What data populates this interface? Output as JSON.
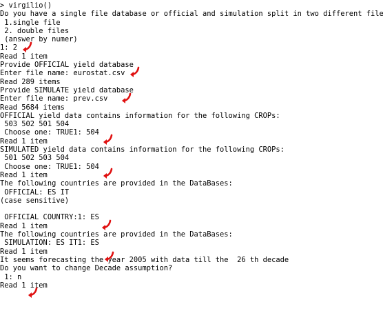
{
  "console": {
    "lines": [
      "> virgilio()",
      "Do you have a single file database or official and simulation split in two different files?",
      " 1.single file",
      " 2. double files",
      " (answer by numer)",
      "1: 2",
      "Read 1 item",
      "Provide OFFICIAL yield database",
      "Enter file name: eurostat.csv",
      "Read 289 items",
      "Provide SIMULATE yield database",
      "Enter file name: prev.csv",
      "Read 5684 items",
      "OFFICIAL yield data contains information for the following CROPs:",
      " 503 502 501 504",
      " Choose one: TRUE1: 504",
      "Read 1 item",
      "SIMULATED yield data contains information for the following CROPs:",
      " 501 502 503 504",
      " Choose one: TRUE1: 504",
      "Read 1 item",
      "The following countries are provided in the DataBases:",
      " OFFICIAL: ES IT",
      "(case sensitive)",
      "",
      " OFFICIAL COUNTRY:1: ES",
      "Read 1 item",
      "The following countries are provided in the DataBases:",
      " SIMULATION: ES IT1: ES",
      "Read 1 item",
      "It seems forecasting the year 2005 with data till the  26 th decade",
      "Do you want to change Decade assumption?",
      " 1: n",
      "Read 1 item"
    ],
    "marker_icon": "red-curved-arrow-icon",
    "marker_color": "#e01010",
    "text_color": "#000000",
    "background": "#ffffff"
  }
}
